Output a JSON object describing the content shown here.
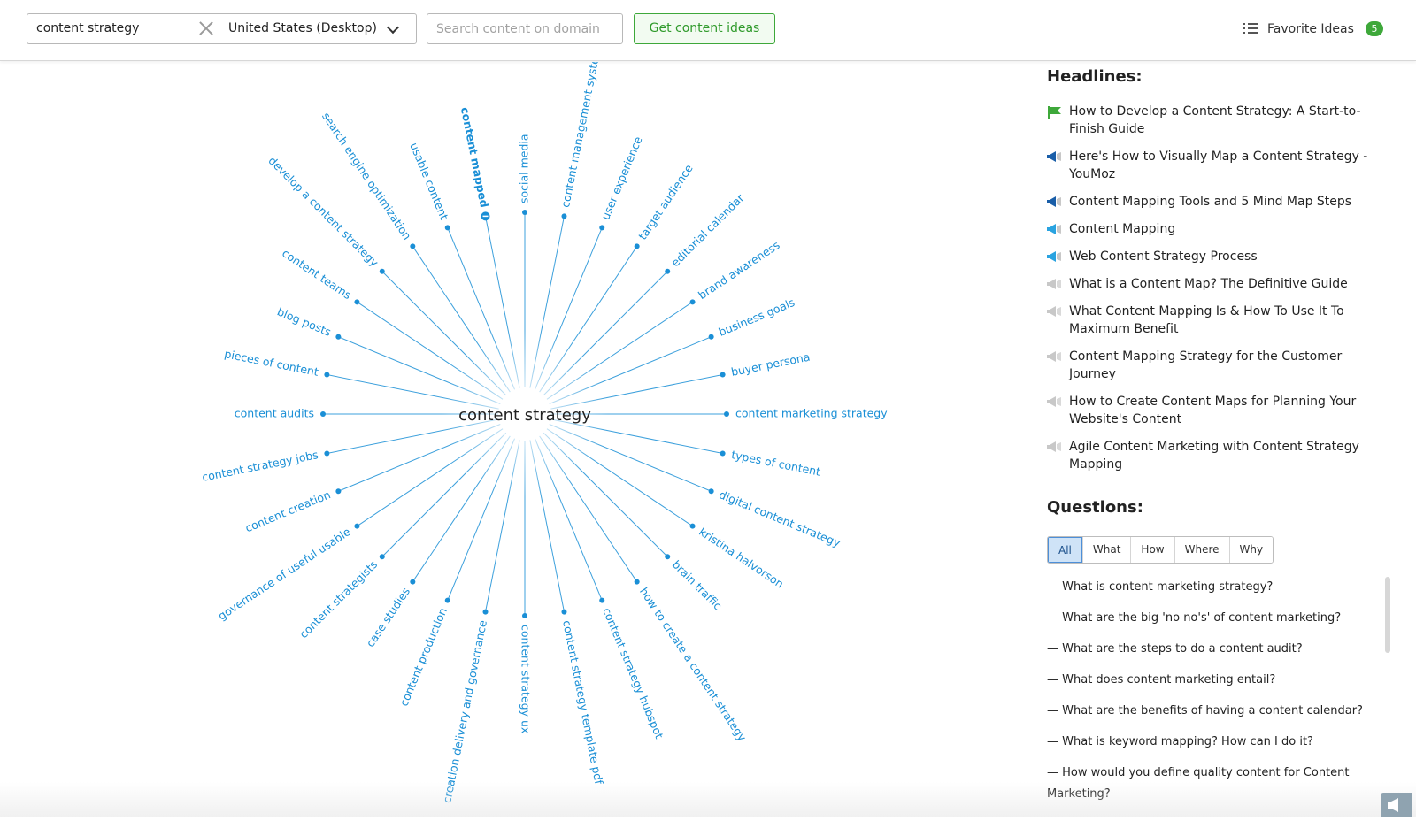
{
  "toolbar": {
    "keyword": "content strategy",
    "database": "United States (Desktop)",
    "domain_placeholder": "Search content on domain",
    "ideas_button": "Get content ideas",
    "favorites_label": "Favorite Ideas",
    "favorites_count": "5"
  },
  "mindmap": {
    "center": "content strategy",
    "selected_topic": "content mapped",
    "link_color": "#1a8fd6",
    "topics": [
      "content management system",
      "user experience",
      "target audience",
      "editorial calendar",
      "brand awareness",
      "business goals",
      "buyer persona",
      "content marketing strategy",
      "types of content",
      "digital content strategy",
      "kristina halvorson",
      "brain traffic",
      "how to create a content strategy",
      "content strategy hubspot",
      "content strategy template pdf",
      "content strategy ux",
      "creation delivery and governance",
      "content production",
      "case studies",
      "content strategists",
      "governance of useful usable",
      "content creation",
      "content strategy jobs",
      "content audits",
      "pieces of content",
      "blog posts",
      "content teams",
      "develop a content strategy",
      "search engine optimization",
      "usable content",
      "content mapped",
      "social media"
    ]
  },
  "headlines": {
    "title": "Headlines:",
    "items": [
      {
        "text": "How to Develop a Content Strategy: A Start-to-Finish Guide",
        "icon": "green-flag-icon"
      },
      {
        "text": "Here's How to Visually Map a Content Strategy - YouMoz",
        "icon": "megaphone-icon-strong"
      },
      {
        "text": "Content Mapping Tools and 5 Mind Map Steps",
        "icon": "megaphone-icon-strong"
      },
      {
        "text": "Content Mapping",
        "icon": "megaphone-icon-medium"
      },
      {
        "text": "Web Content Strategy Process",
        "icon": "megaphone-icon-medium"
      },
      {
        "text": "What is a Content Map? The Definitive Guide",
        "icon": "megaphone-icon-weak"
      },
      {
        "text": "What Content Mapping Is & How To Use It To Maximum Benefit",
        "icon": "megaphone-icon-weak"
      },
      {
        "text": "Content Mapping Strategy for the Customer Journey",
        "icon": "megaphone-icon-weak"
      },
      {
        "text": "How to Create Content Maps for Planning Your Website's Content",
        "icon": "megaphone-icon-weak"
      },
      {
        "text": "Agile Content Marketing with Content Strategy Mapping",
        "icon": "megaphone-icon-weak"
      }
    ]
  },
  "questions": {
    "title": "Questions:",
    "tabs": [
      "All",
      "What",
      "How",
      "Where",
      "Why"
    ],
    "active_tab": "All",
    "items": [
      "— What is content marketing strategy?",
      "— What are the big 'no no's' of content marketing?",
      "— What are the steps to do a content audit?",
      "— What does content marketing entail?",
      "— What are the benefits of having a content calendar?",
      "— What is keyword mapping? How can I do it?",
      "— How would you define quality content for Content Marketing?"
    ]
  }
}
